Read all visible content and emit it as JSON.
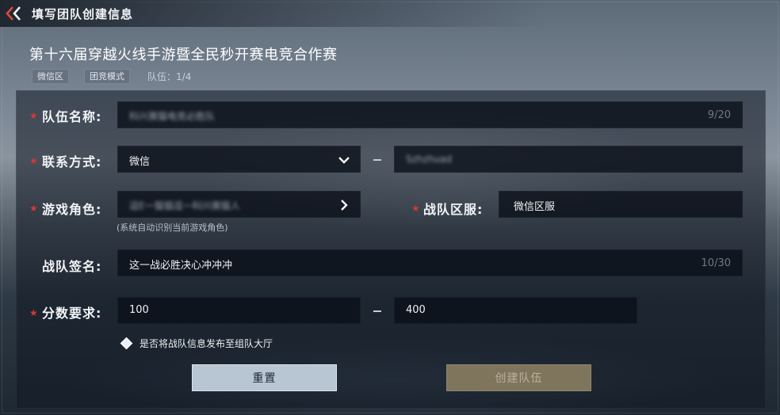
{
  "header": {
    "page_title": "填写团队创建信息",
    "event_title": "第十六届穿越火线手游暨全民秒开赛电竞合作赛",
    "tags": [
      "微信区",
      "团竞模式"
    ],
    "team_count_label": "队伍：",
    "team_count_value": "1/4"
  },
  "form": {
    "team_name": {
      "label": "队伍名称:",
      "value": "科兴赛猫电竞必胜队",
      "counter": "9/20"
    },
    "contact": {
      "label": "联系方式:",
      "method": "微信",
      "value": "Szhzhuad"
    },
    "game_role": {
      "label": "游戏角色:",
      "value": "逗E一猫猫逗一科兴赛猫人",
      "hint": "(系统自动识别当前游戏角色)"
    },
    "server": {
      "label": "战队区服:",
      "value": "微信区服"
    },
    "signature": {
      "label": "战队签名:",
      "value": "这一战必胜决心冲冲冲",
      "counter": "10/30"
    },
    "score": {
      "label": "分数要求:",
      "min": "100",
      "max": "400"
    },
    "publish": {
      "label": "是否将战队信息发布至组队大厅",
      "checked": true
    }
  },
  "buttons": {
    "reset": "重置",
    "create": "创建队伍"
  },
  "colors": {
    "required_star": "#d33b2f",
    "reset_bg": "#b8c5d2",
    "create_bg": "#7f755c",
    "back_arrow": "#d94a3a"
  },
  "icons": [
    "back-arrow-icon",
    "chevron-down-icon",
    "chevron-right-icon",
    "diamond-check-icon"
  ]
}
